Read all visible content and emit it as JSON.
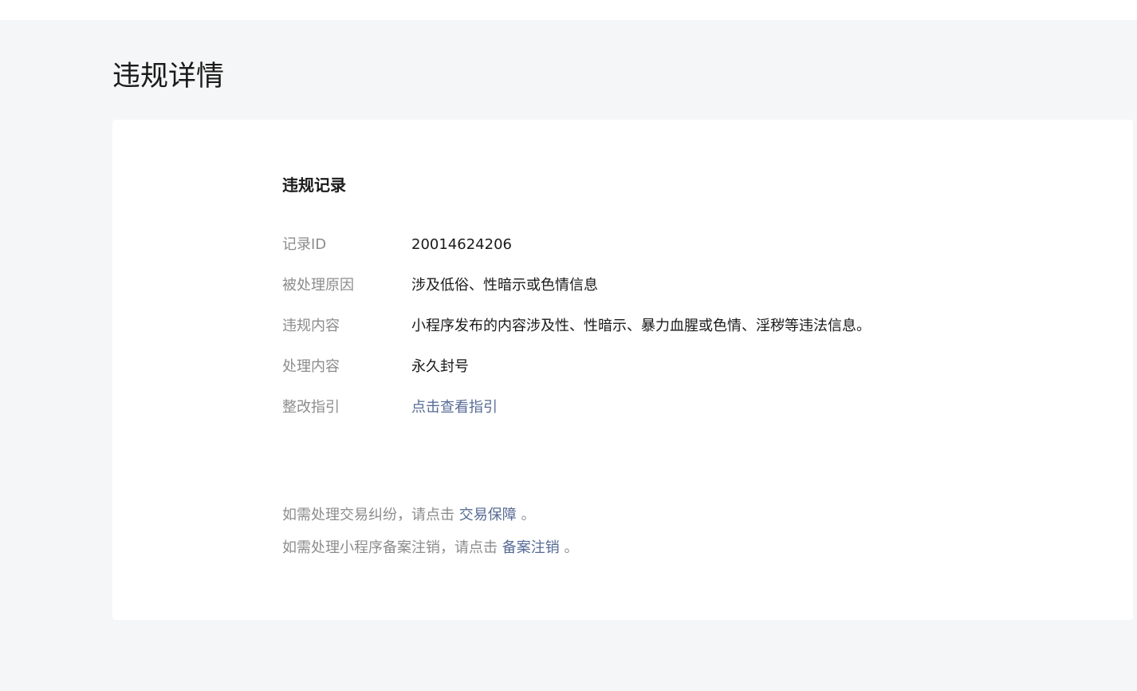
{
  "page": {
    "title": "违规详情"
  },
  "record": {
    "section_title": "违规记录",
    "rows": [
      {
        "label": "记录ID",
        "value": "20014624206"
      },
      {
        "label": "被处理原因",
        "value": "涉及低俗、性暗示或色情信息"
      },
      {
        "label": "违规内容",
        "value": "小程序发布的内容涉及性、性暗示、暴力血腥或色情、淫秽等违法信息。"
      },
      {
        "label": "处理内容",
        "value": "永久封号"
      },
      {
        "label": "整改指引",
        "value": "点击查看指引"
      }
    ]
  },
  "notes": [
    {
      "prefix": "如需处理交易纠纷，请点击 ",
      "link": "交易保障",
      "suffix": " 。"
    },
    {
      "prefix": "如需处理小程序备案注销，请点击 ",
      "link": "备案注销",
      "suffix": " 。"
    }
  ],
  "colors": {
    "background": "#f5f6f7",
    "card": "#ffffff",
    "link": "#576b95",
    "label": "#8c8c8c",
    "text": "#1a1a1a"
  }
}
